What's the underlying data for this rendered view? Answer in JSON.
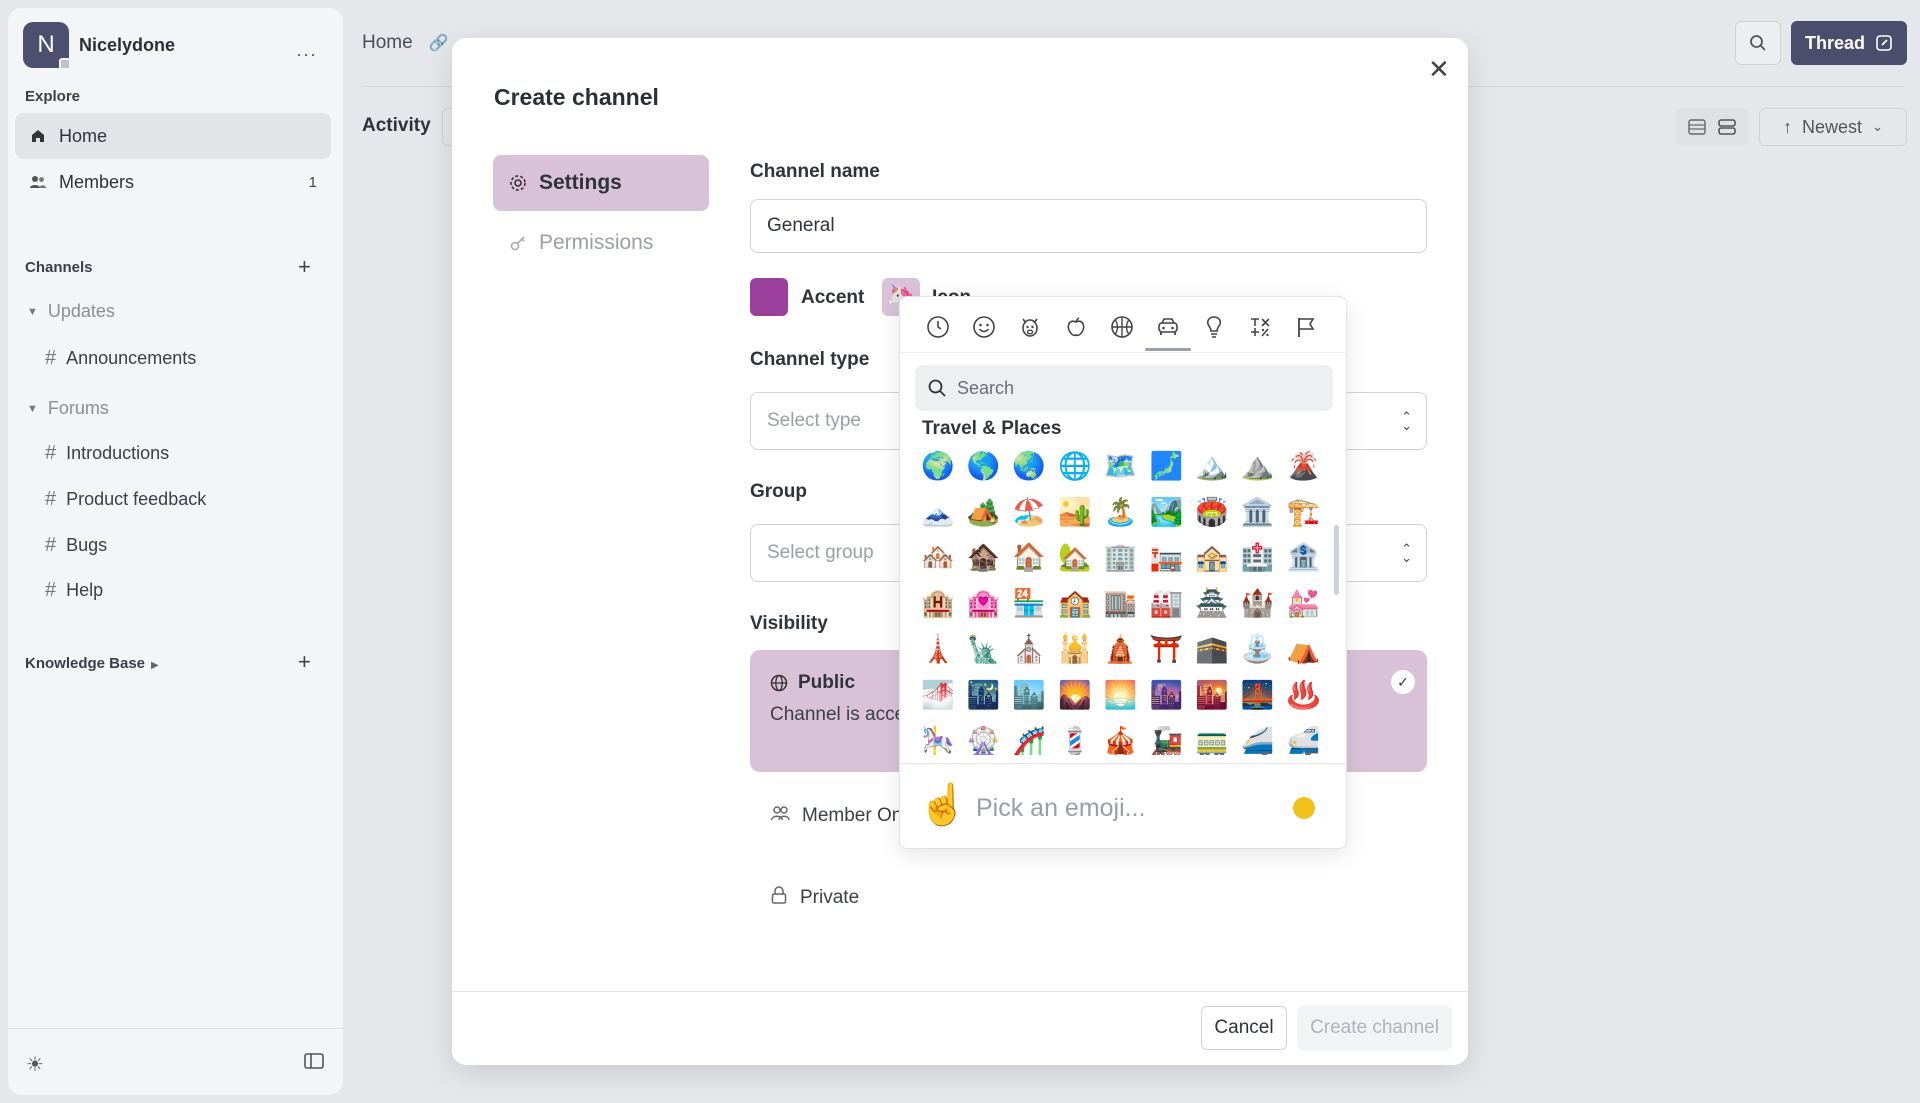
{
  "workspace": {
    "initial": "N",
    "name": "Nicelydone",
    "more": "···"
  },
  "sidebar": {
    "explore_label": "Explore",
    "items": [
      {
        "label": "Home",
        "icon": "home-icon"
      },
      {
        "label": "Members",
        "icon": "members-icon",
        "count": "1"
      }
    ],
    "channels_label": "Channels",
    "groups": [
      {
        "label": "Updates",
        "channels": [
          "Announcements"
        ]
      },
      {
        "label": "Forums",
        "channels": [
          "Introductions",
          "Product feedback",
          "Bugs",
          "Help"
        ]
      }
    ],
    "knowledge_base_label": "Knowledge Base"
  },
  "header": {
    "breadcrumb": "Home",
    "thread_label": "Thread",
    "activity_label": "Activity",
    "sort_label": "Newest"
  },
  "modal": {
    "title": "Create channel",
    "tabs": {
      "settings": "Settings",
      "permissions": "Permissions"
    },
    "channel_name_label": "Channel name",
    "channel_name_value": "General",
    "accent_label": "Accent",
    "accent_color": "#9b3f9c",
    "icon_label": "Icon",
    "icon_value": "🦄",
    "channel_type_label": "Channel type",
    "channel_type_placeholder": "Select type",
    "group_label": "Group",
    "group_placeholder": "Select group",
    "visibility_label": "Visibility",
    "visibility_public_title": "Public",
    "visibility_public_desc": "Channel is accessible to all community members",
    "visibility_member_only": "Member Only",
    "visibility_private": "Private",
    "cancel_label": "Cancel",
    "create_label": "Create channel"
  },
  "emoji_picker": {
    "categories": [
      "recent",
      "smileys",
      "animals",
      "food",
      "activity",
      "travel",
      "objects",
      "symbols",
      "flags"
    ],
    "active_category": "travel",
    "search_placeholder": "Search",
    "section_title": "Travel & Places",
    "emojis": [
      "🌍",
      "🌎",
      "🌏",
      "🌐",
      "🗺️",
      "🗾",
      "🏔️",
      "⛰️",
      "🌋",
      "🗻",
      "🏕️",
      "🏖️",
      "🏜️",
      "🏝️",
      "🏞️",
      "🏟️",
      "🏛️",
      "🏗️",
      "🏘️",
      "🏚️",
      "🏠",
      "🏡",
      "🏢",
      "🏣",
      "🏤",
      "🏥",
      "🏦",
      "🏨",
      "🏩",
      "🏪",
      "🏫",
      "🏬",
      "🏭",
      "🏯",
      "🏰",
      "💒",
      "🗼",
      "🗽",
      "⛪",
      "🕌",
      "🛕",
      "⛩️",
      "🕋",
      "⛲",
      "⛺",
      "🌁",
      "🌃",
      "🏙️",
      "🌄",
      "🌅",
      "🌆",
      "🌇",
      "🌉",
      "♨️",
      "🎠",
      "🎡",
      "🎢",
      "💈",
      "🎪",
      "🚂",
      "🚃",
      "🚄",
      "🚅"
    ],
    "pick_hand": "☝️",
    "pick_label": "Pick an emoji...",
    "skin_tone_color": "#f1c21b"
  }
}
